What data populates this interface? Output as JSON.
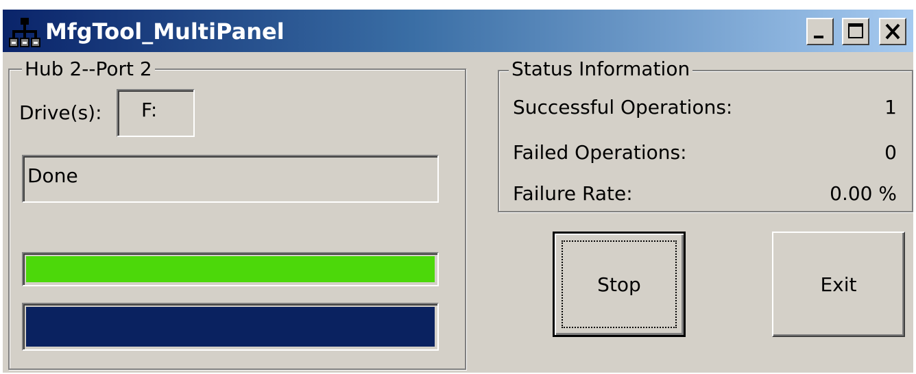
{
  "window": {
    "title": "MfgTool_MultiPanel",
    "icon": "usb-hub-icon",
    "controls": [
      "minimize-icon",
      "maximize-icon",
      "close-icon"
    ]
  },
  "hub_panel": {
    "legend": "Hub 2--Port 2",
    "drive_label": "Drive(s):",
    "drive_value": "F:",
    "status_text": "Done",
    "progress_bars": [
      {
        "name": "operation-progress",
        "percent": 100,
        "color": "#4cd80a"
      },
      {
        "name": "overall-progress",
        "percent": 100,
        "color": "#0a2260"
      }
    ]
  },
  "status_panel": {
    "legend": "Status Information",
    "rows": [
      {
        "label": "Successful Operations:",
        "value": "1"
      },
      {
        "label": "Failed Operations:",
        "value": "0"
      },
      {
        "label": "Failure Rate:",
        "value": "0.00 %"
      }
    ]
  },
  "buttons": {
    "stop_label": "Stop",
    "exit_label": "Exit"
  },
  "colors": {
    "face": "#d4d0c8",
    "title_gradient_start": "#0a246a",
    "title_gradient_end": "#a6caf0"
  }
}
